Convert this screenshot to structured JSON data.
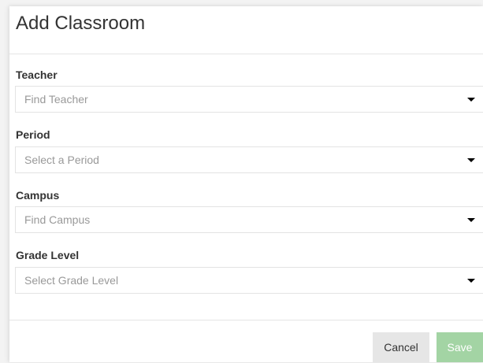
{
  "dialog": {
    "title": "Add Classroom"
  },
  "fields": {
    "teacher": {
      "label": "Teacher",
      "placeholder": "Find Teacher",
      "icon": "caret-down-icon"
    },
    "period": {
      "label": "Period",
      "placeholder": "Select a Period",
      "icon": "caret-down-icon"
    },
    "campus": {
      "label": "Campus",
      "placeholder": "Find Campus",
      "icon": "caret-down-icon"
    },
    "grade_level": {
      "label": "Grade Level",
      "placeholder": "Select Grade Level",
      "icon": "caret-down-icon"
    }
  },
  "footer": {
    "cancel_label": "Cancel",
    "save_label": "Save"
  },
  "colors": {
    "save_button_bg": "#a3d4a4",
    "cancel_button_bg": "#e6e6e6",
    "placeholder_text": "#999999",
    "label_text": "#333333",
    "border": "#e3e3e3"
  }
}
